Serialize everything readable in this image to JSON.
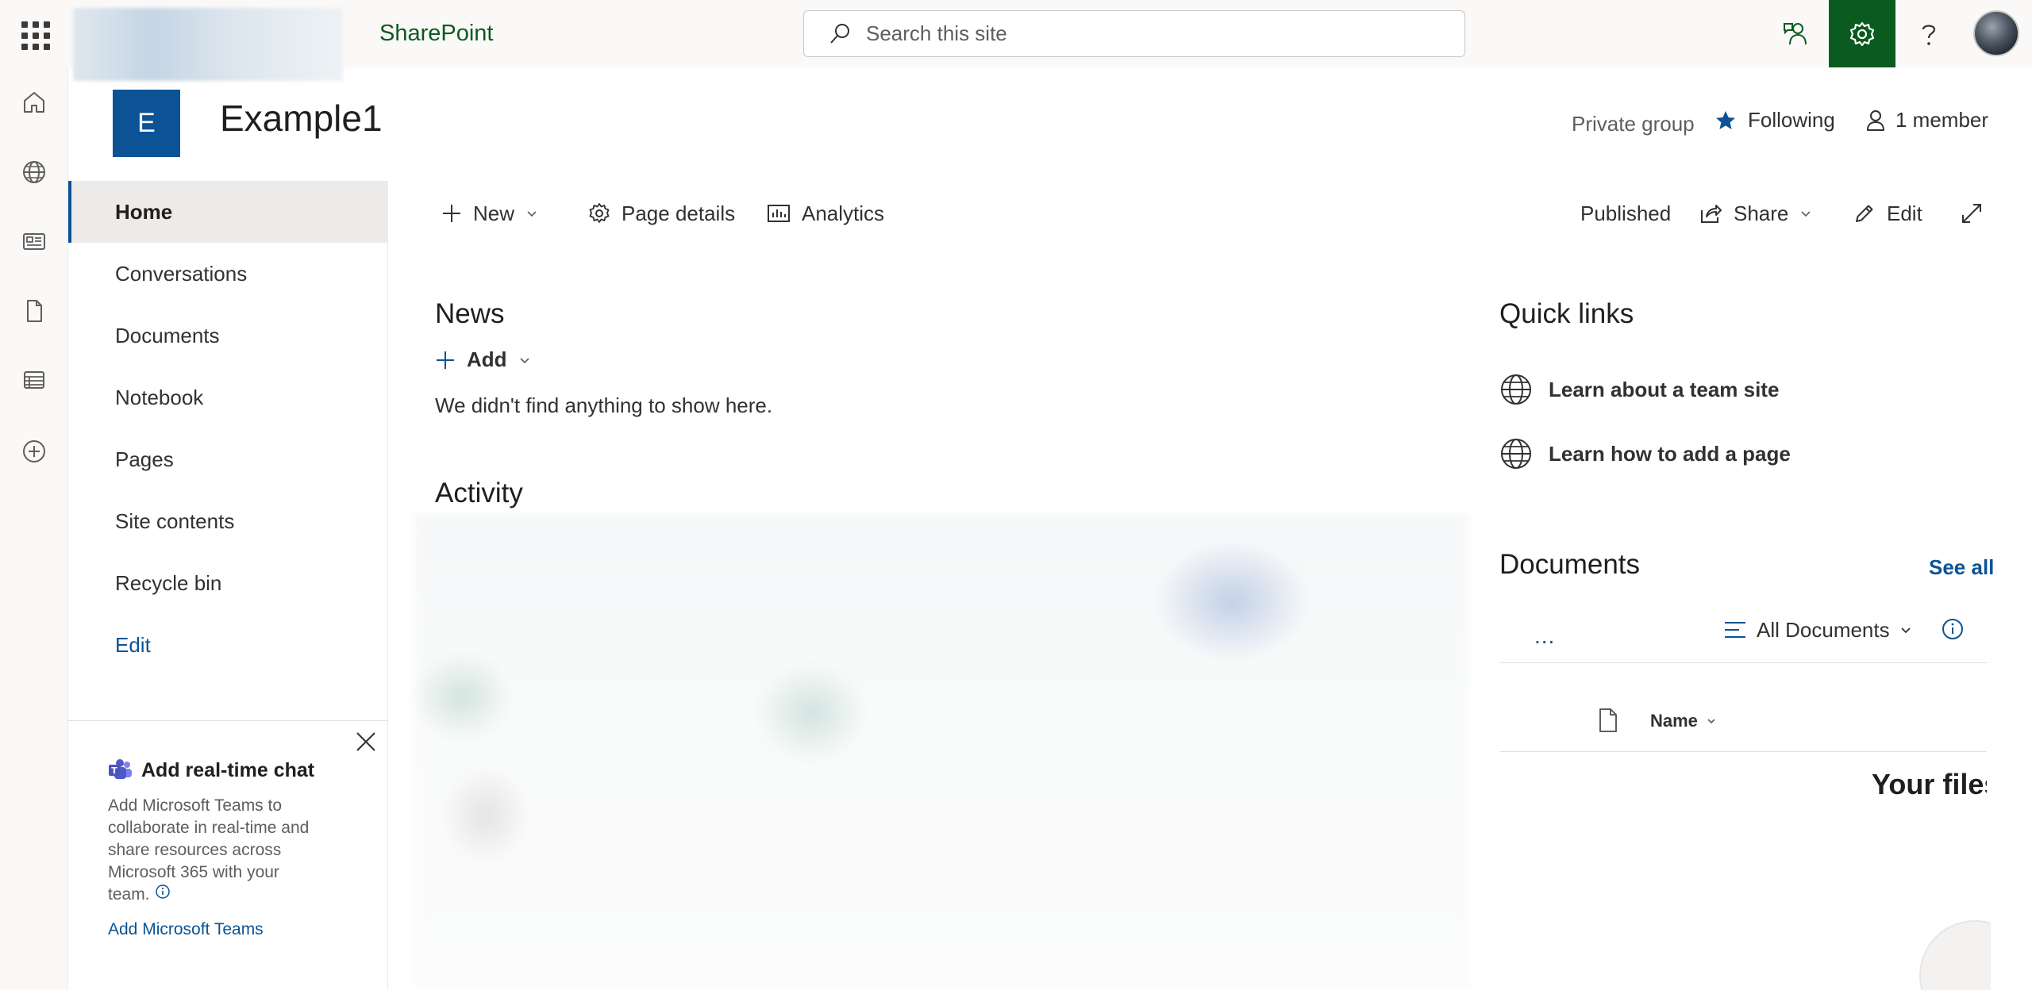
{
  "suite": {
    "app_name": "SharePoint",
    "search_placeholder": "Search this site",
    "brand_green": "#0b5a1f"
  },
  "appbar": {
    "icons": [
      "home-icon",
      "globe-icon",
      "news-icon",
      "files-icon",
      "lists-icon",
      "create-icon"
    ]
  },
  "site": {
    "logo_letter": "E",
    "title": "Example1",
    "privacy": "Private group",
    "following": "Following",
    "members": "1 member",
    "accent": "#0b5394"
  },
  "nav": {
    "items": [
      "Home",
      "Conversations",
      "Documents",
      "Notebook",
      "Pages",
      "Site contents",
      "Recycle bin"
    ],
    "edit": "Edit"
  },
  "chat_card": {
    "title": "Add real-time chat",
    "body": "Add Microsoft Teams to collaborate in real-time and share resources across Microsoft 365 with your team.",
    "link": "Add Microsoft Teams"
  },
  "commandbar": {
    "new": "New",
    "page_details": "Page details",
    "analytics": "Analytics",
    "status": "Published",
    "share": "Share",
    "edit": "Edit"
  },
  "news": {
    "heading": "News",
    "add": "Add",
    "empty": "We didn't find anything to show here."
  },
  "activity": {
    "heading": "Activity"
  },
  "quick_links": {
    "heading": "Quick links",
    "items": [
      "Learn about a team site",
      "Learn how to add a page"
    ]
  },
  "documents": {
    "heading": "Documents",
    "see_all": "See all",
    "more": "...",
    "view": "All Documents",
    "column_name": "Name",
    "empty_title": "Your files"
  }
}
